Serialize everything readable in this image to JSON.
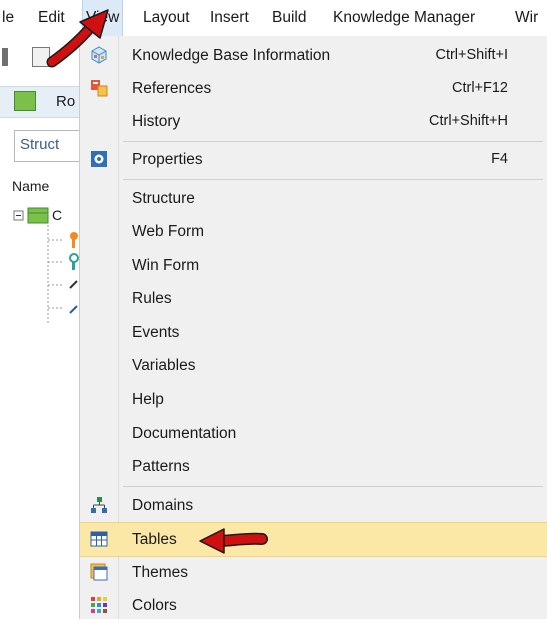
{
  "menubar": {
    "items": [
      "le",
      "Edit",
      "View",
      "Layout",
      "Insert",
      "Build",
      "Knowledge Manager",
      "Wir"
    ]
  },
  "background": {
    "tab_label": "Ro",
    "struct_label": "Struct",
    "name_header": "Name",
    "tree_root": "C"
  },
  "view_menu": {
    "groups": [
      [
        {
          "label": "Knowledge Base Information",
          "shortcut": "Ctrl+Shift+I",
          "icon": "kb-cube-icon"
        },
        {
          "label": "References",
          "shortcut": "Ctrl+F12",
          "icon": "references-icon"
        },
        {
          "label": "History",
          "shortcut": "Ctrl+Shift+H",
          "icon": ""
        }
      ],
      [
        {
          "label": "Properties",
          "shortcut": "F4",
          "icon": "properties-gear-icon"
        }
      ],
      [
        {
          "label": "Structure",
          "shortcut": "",
          "icon": ""
        },
        {
          "label": "Web Form",
          "shortcut": "",
          "icon": ""
        },
        {
          "label": "Win Form",
          "shortcut": "",
          "icon": ""
        },
        {
          "label": "Rules",
          "shortcut": "",
          "icon": ""
        },
        {
          "label": "Events",
          "shortcut": "",
          "icon": ""
        },
        {
          "label": "Variables",
          "shortcut": "",
          "icon": ""
        },
        {
          "label": "Help",
          "shortcut": "",
          "icon": ""
        },
        {
          "label": "Documentation",
          "shortcut": "",
          "icon": ""
        },
        {
          "label": "Patterns",
          "shortcut": "",
          "icon": ""
        }
      ],
      [
        {
          "label": "Domains",
          "shortcut": "",
          "icon": "domains-icon"
        },
        {
          "label": "Tables",
          "shortcut": "",
          "icon": "tables-grid-icon",
          "highlighted": true
        },
        {
          "label": "Themes",
          "shortcut": "",
          "icon": "themes-icon"
        },
        {
          "label": "Colors",
          "shortcut": "",
          "icon": "colors-palette-icon"
        }
      ]
    ]
  },
  "colors": {
    "highlight": "#fbe8a6",
    "arrow": "#d01010",
    "active_menu": "#dceaf7"
  }
}
